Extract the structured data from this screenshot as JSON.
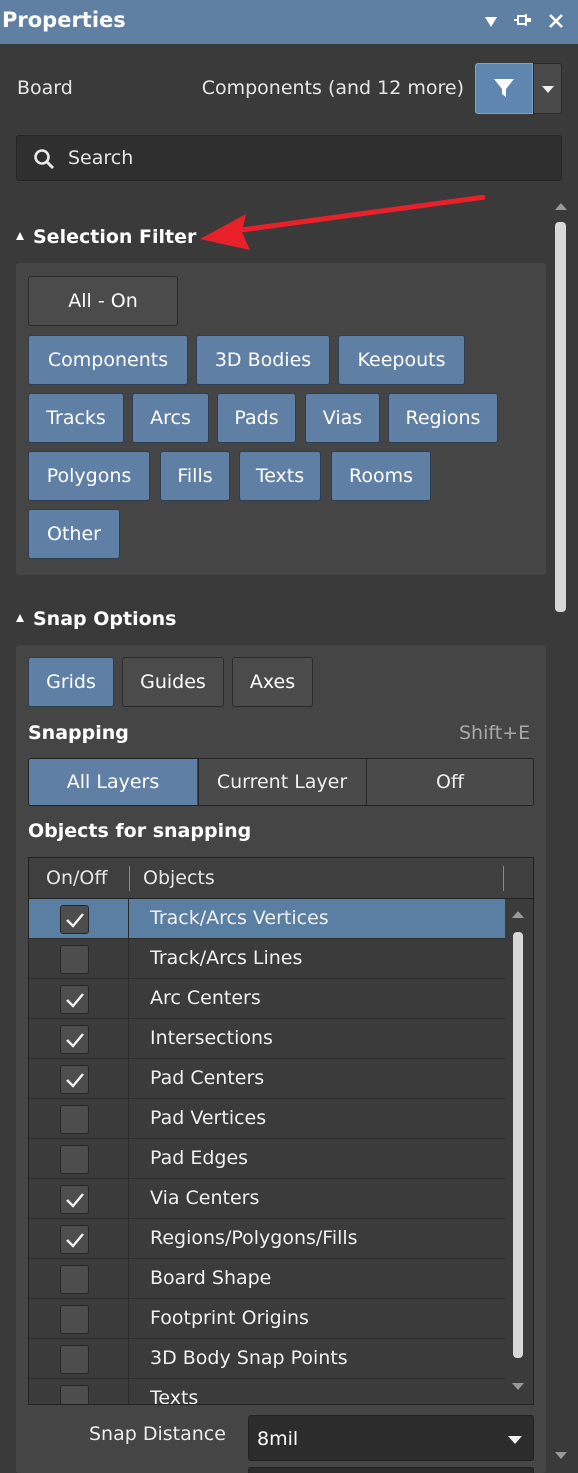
{
  "window": {
    "title": "Properties",
    "controls": [
      "dropdown-triangle-icon",
      "pin-icon",
      "close-icon"
    ]
  },
  "context": {
    "board_label": "Board",
    "components_label": "Components (and 12 more)"
  },
  "search": {
    "placeholder": "Search"
  },
  "selection_filter": {
    "heading": "Selection Filter",
    "all_on": "All - On",
    "chips": [
      {
        "label": "Components",
        "active": true
      },
      {
        "label": "3D Bodies",
        "active": true
      },
      {
        "label": "Keepouts",
        "active": true
      },
      {
        "label": "Tracks",
        "active": true
      },
      {
        "label": "Arcs",
        "active": true
      },
      {
        "label": "Pads",
        "active": true
      },
      {
        "label": "Vias",
        "active": true
      },
      {
        "label": "Regions",
        "active": true
      },
      {
        "label": "Polygons",
        "active": true
      },
      {
        "label": "Fills",
        "active": true
      },
      {
        "label": "Texts",
        "active": true
      },
      {
        "label": "Rooms",
        "active": true
      },
      {
        "label": "Other",
        "active": true
      }
    ]
  },
  "snap_options": {
    "heading": "Snap Options",
    "guides_toggles": [
      {
        "label": "Grids",
        "active": true
      },
      {
        "label": "Guides",
        "active": false
      },
      {
        "label": "Axes",
        "active": false
      }
    ],
    "snapping_label": "Snapping",
    "snapping_shortcut": "Shift+E",
    "snapping_modes": [
      {
        "label": "All Layers",
        "active": true
      },
      {
        "label": "Current Layer",
        "active": false
      },
      {
        "label": "Off",
        "active": false
      }
    ],
    "objects_label": "Objects for snapping",
    "table": {
      "col_onoff": "On/Off",
      "col_objects": "Objects",
      "rows": [
        {
          "label": "Track/Arcs Vertices",
          "checked": true,
          "selected": true
        },
        {
          "label": "Track/Arcs Lines",
          "checked": false,
          "selected": false
        },
        {
          "label": "Arc Centers",
          "checked": true,
          "selected": false
        },
        {
          "label": "Intersections",
          "checked": true,
          "selected": false
        },
        {
          "label": "Pad Centers",
          "checked": true,
          "selected": false
        },
        {
          "label": "Pad Vertices",
          "checked": false,
          "selected": false
        },
        {
          "label": "Pad Edges",
          "checked": false,
          "selected": false
        },
        {
          "label": "Via Centers",
          "checked": true,
          "selected": false
        },
        {
          "label": "Regions/Polygons/Fills",
          "checked": true,
          "selected": false
        },
        {
          "label": "Board Shape",
          "checked": false,
          "selected": false
        },
        {
          "label": "Footprint Origins",
          "checked": false,
          "selected": false
        },
        {
          "label": "3D Body Snap Points",
          "checked": false,
          "selected": false
        },
        {
          "label": "Texts",
          "checked": false,
          "selected": false
        }
      ]
    },
    "snap_distance_label": "Snap Distance",
    "snap_distance_value": "8mil"
  },
  "colors": {
    "accent": "#5f80a4",
    "titlebar": "#5f7fa3",
    "background": "#3a3a3a",
    "annotation_arrow": "#e8202a"
  }
}
